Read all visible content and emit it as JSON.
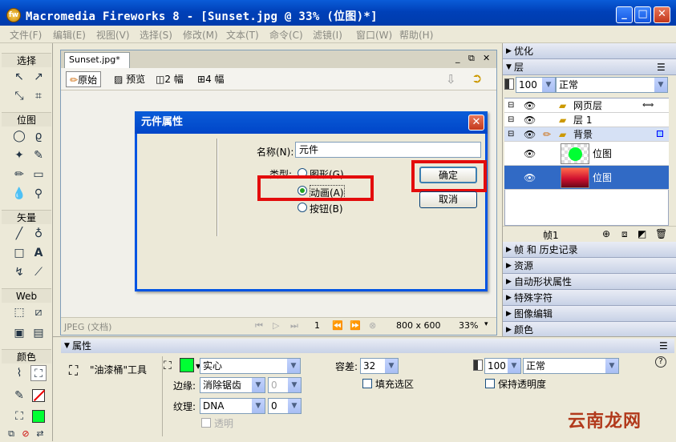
{
  "app": {
    "title": "Macromedia Fireworks 8 - [Sunset.jpg @  33% (位图)*]",
    "icon_label": "fw"
  },
  "window_controls": {
    "minimize": "_",
    "maximize": "□",
    "close": "✕"
  },
  "menu": [
    "文件(F)",
    "编辑(E)",
    "视图(V)",
    "选择(S)",
    "修改(M)",
    "文本(T)",
    "命令(C)",
    "滤镜(I)",
    "窗口(W)",
    "帮助(H)"
  ],
  "toolbox": {
    "sections": {
      "select": "选择",
      "bitmap": "位图",
      "vector": "矢量",
      "web": "Web",
      "colors": "颜色"
    }
  },
  "document": {
    "tab_label": "Sunset.jpg*",
    "view_buttons": {
      "original": "原始",
      "preview": "预览",
      "two_up": "2 幅",
      "four_up": "4 幅"
    },
    "status": {
      "format": "JPEG (文档)",
      "frame": "1",
      "canvas_size": "800 x 600",
      "zoom": "33%"
    }
  },
  "dialog": {
    "title": "元件属性",
    "name_label": "名称(N):",
    "name_value": "元件",
    "type_label": "类型:",
    "types": [
      "图形(G)",
      "动画(A)",
      "按钮(B)"
    ],
    "selected_type": "动画(A)",
    "ok_label": "确定",
    "cancel_label": "取消"
  },
  "rightpanel": {
    "optimize_label": "优化",
    "layers_label": "层",
    "opacity": "100",
    "blend_mode": "正常",
    "layers": [
      {
        "name": "网页层"
      },
      {
        "name": "层 1"
      },
      {
        "name": "背景"
      }
    ],
    "objects": [
      {
        "name": "位图"
      },
      {
        "name": "位图"
      }
    ],
    "frame_label": "帧1",
    "collapsed_panels": [
      "帧 和 历史记录",
      "资源",
      "自动形状属性",
      "特殊字符",
      "图像编辑",
      "颜色"
    ]
  },
  "properties": {
    "title": "属性",
    "tool_name": "\"油漆桶\"工具",
    "fill_type": "实心",
    "edge_label": "边缘:",
    "edge_value": "消除锯齿",
    "edge_amount": "0",
    "texture_label": "纹理:",
    "texture_value": "DNA",
    "texture_amount": "0",
    "transparent_label": "透明",
    "tolerance_label": "容差:",
    "tolerance_value": "32",
    "fill_selection_label": "填充选区",
    "opacity_value": "100",
    "blend_mode": "正常",
    "preserve_transparency_label": "保持透明度",
    "fill_color": "#00ff33"
  },
  "watermark": "云南龙网",
  "colors": {
    "titlebar": "#0a5cd8",
    "highlight_red": "#e30c0c",
    "selected_row": "#316ac5",
    "fill_green": "#00ff33"
  }
}
